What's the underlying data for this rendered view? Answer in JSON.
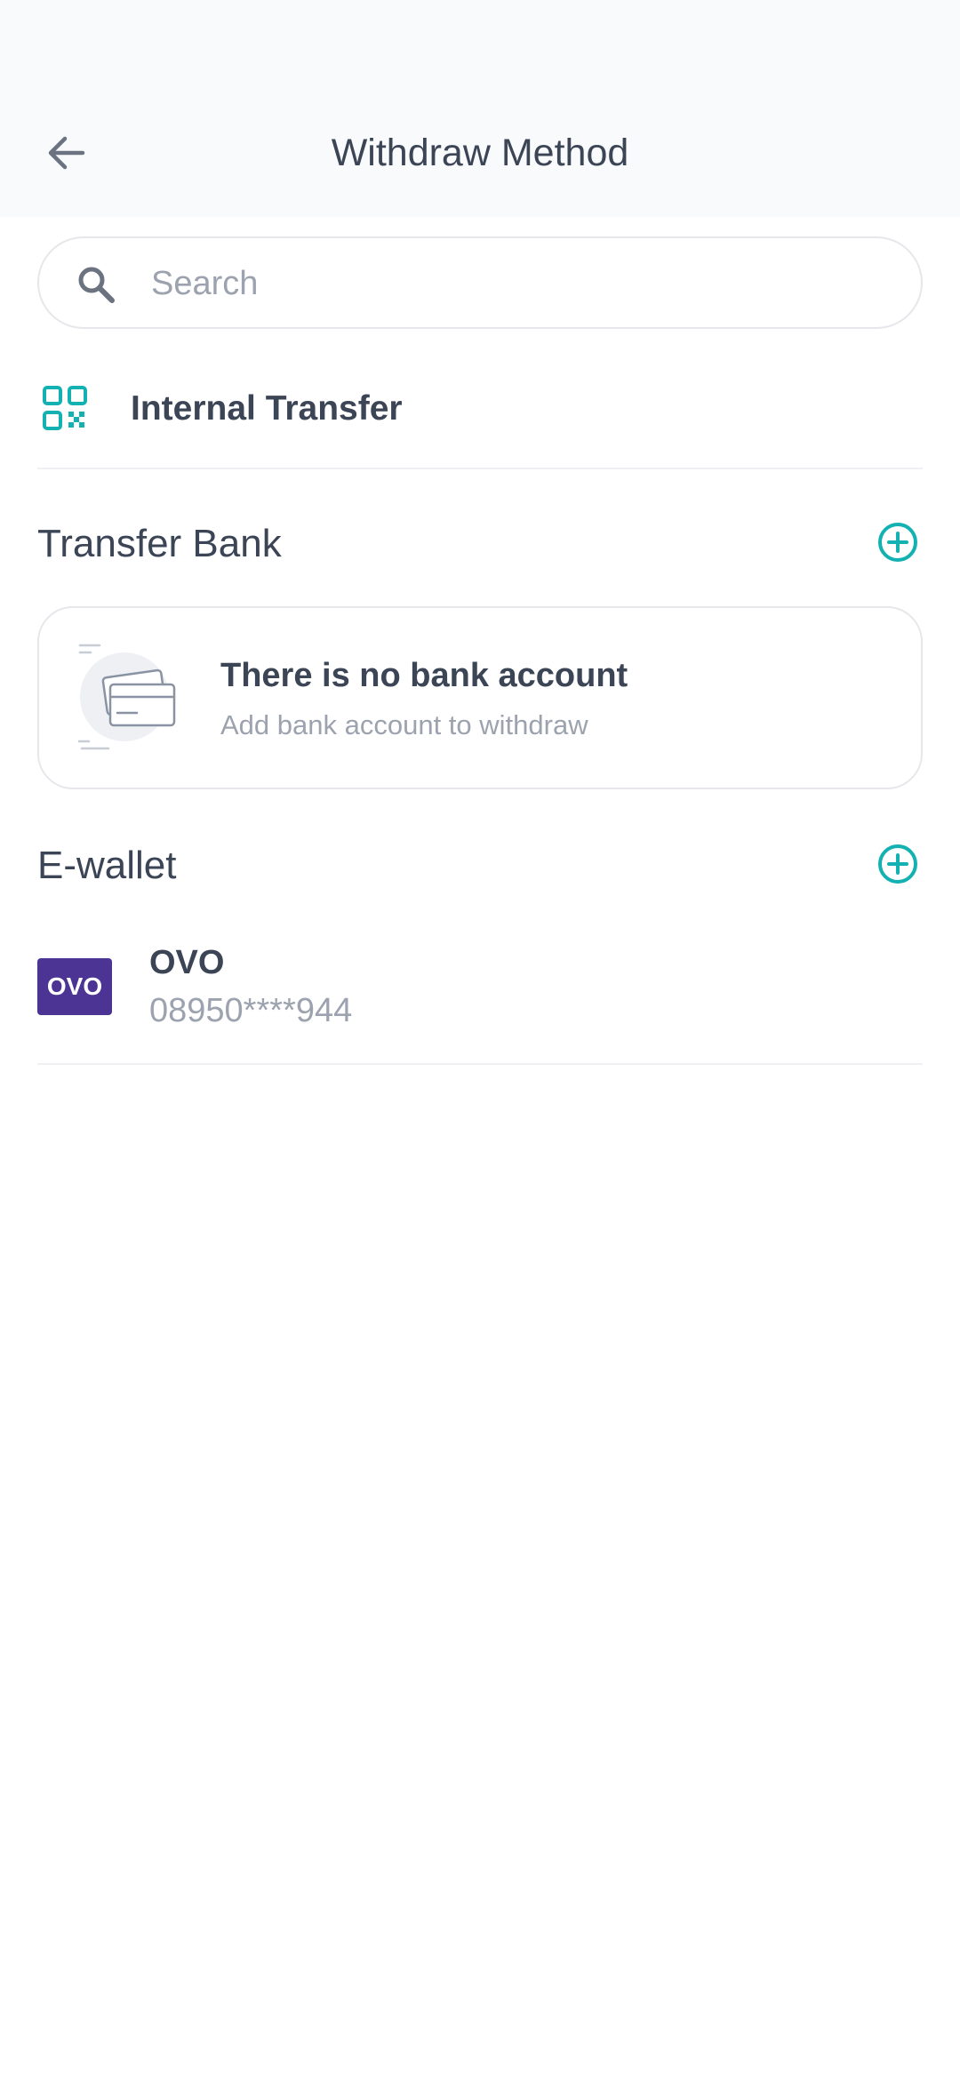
{
  "header": {
    "title": "Withdraw Method",
    "back_icon": "arrow-left-icon"
  },
  "search": {
    "placeholder": "Search",
    "value": "",
    "icon": "search-icon"
  },
  "internal_transfer": {
    "label": "Internal Transfer",
    "icon": "qr-code-icon"
  },
  "transfer_bank": {
    "title": "Transfer Bank",
    "add_icon": "plus-circle-icon",
    "empty_state": {
      "title": "There is no bank account",
      "subtitle": "Add bank account to withdraw",
      "illustration": "bank-card-illustration"
    }
  },
  "ewallet": {
    "title": "E-wallet",
    "add_icon": "plus-circle-icon",
    "items": [
      {
        "logo_text": "OVO",
        "name": "OVO",
        "number": "08950****944",
        "logo_color": "#4c3494"
      }
    ]
  },
  "colors": {
    "accent": "#14b1b3",
    "text_primary": "#3b4556",
    "text_muted": "#9ca3af",
    "border": "#e5e7eb",
    "header_bg": "#f9fafb"
  }
}
